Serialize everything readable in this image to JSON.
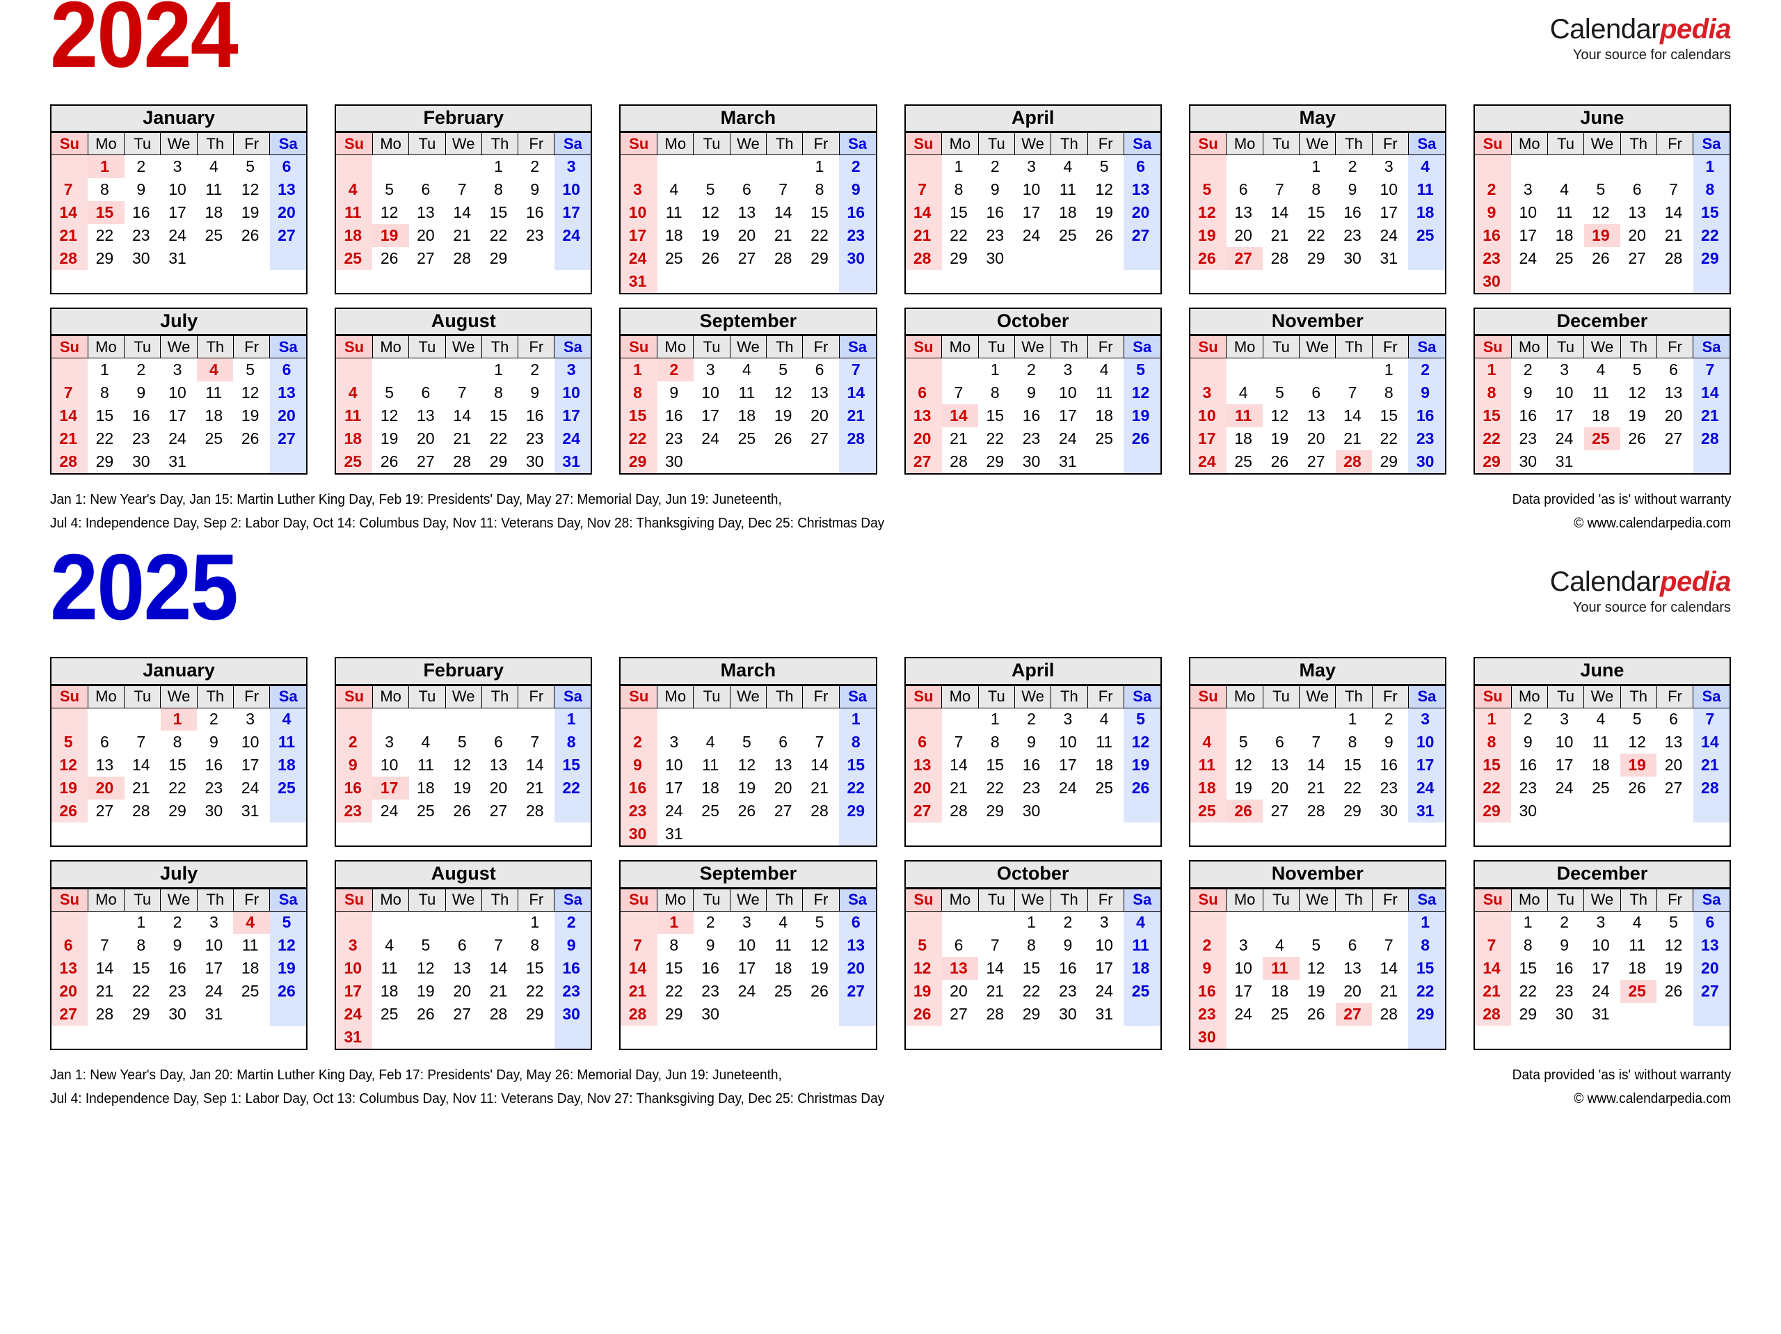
{
  "brand": {
    "name_part1": "Calendar",
    "name_part2": "pedia",
    "tagline": "Your source for calendars"
  },
  "weekday_headers": [
    "Su",
    "Mo",
    "Tu",
    "We",
    "Th",
    "Fr",
    "Sa"
  ],
  "colors": {
    "year_2024": "#cc0000",
    "year_2025": "#0000cc",
    "sunday_bg": "#fcdede",
    "sunday_text": "#cc0000",
    "saturday_bg": "#dbe5fb",
    "saturday_text": "#0000dd",
    "holiday_bg": "#fcdada",
    "holiday_text": "#cc0000",
    "header_bg": "#e8e8e8",
    "brand_red": "#d81f26"
  },
  "years": [
    {
      "id": "y2024",
      "title": "2024",
      "months": [
        {
          "name": "January",
          "first_weekday": 1,
          "days": 31,
          "holidays": [
            1,
            15
          ]
        },
        {
          "name": "February",
          "first_weekday": 4,
          "days": 29,
          "holidays": [
            19
          ]
        },
        {
          "name": "March",
          "first_weekday": 5,
          "days": 31,
          "holidays": []
        },
        {
          "name": "April",
          "first_weekday": 1,
          "days": 30,
          "holidays": []
        },
        {
          "name": "May",
          "first_weekday": 3,
          "days": 31,
          "holidays": [
            27
          ]
        },
        {
          "name": "June",
          "first_weekday": 6,
          "days": 30,
          "holidays": [
            19
          ]
        },
        {
          "name": "July",
          "first_weekday": 1,
          "days": 31,
          "holidays": [
            4
          ]
        },
        {
          "name": "August",
          "first_weekday": 4,
          "days": 31,
          "holidays": []
        },
        {
          "name": "September",
          "first_weekday": 0,
          "days": 30,
          "holidays": [
            2
          ]
        },
        {
          "name": "October",
          "first_weekday": 2,
          "days": 31,
          "holidays": [
            14
          ]
        },
        {
          "name": "November",
          "first_weekday": 5,
          "days": 30,
          "holidays": [
            11,
            28
          ]
        },
        {
          "name": "December",
          "first_weekday": 0,
          "days": 31,
          "holidays": [
            25
          ]
        }
      ],
      "footer_left_line1": "Jan 1: New Year's Day, Jan 15: Martin Luther King Day, Feb 19: Presidents' Day, May 27: Memorial Day, Jun 19: Juneteenth,",
      "footer_left_line2": "Jul 4: Independence Day, Sep 2: Labor Day, Oct 14: Columbus Day, Nov 11: Veterans Day, Nov 28: Thanksgiving Day, Dec 25: Christmas Day",
      "footer_right_line1": "Data provided 'as is' without warranty",
      "footer_right_line2": "© www.calendarpedia.com"
    },
    {
      "id": "y2025",
      "title": "2025",
      "months": [
        {
          "name": "January",
          "first_weekday": 3,
          "days": 31,
          "holidays": [
            1,
            20
          ]
        },
        {
          "name": "February",
          "first_weekday": 6,
          "days": 28,
          "holidays": [
            17
          ]
        },
        {
          "name": "March",
          "first_weekday": 6,
          "days": 31,
          "holidays": []
        },
        {
          "name": "April",
          "first_weekday": 2,
          "days": 30,
          "holidays": []
        },
        {
          "name": "May",
          "first_weekday": 4,
          "days": 31,
          "holidays": [
            26
          ]
        },
        {
          "name": "June",
          "first_weekday": 0,
          "days": 30,
          "holidays": [
            19
          ]
        },
        {
          "name": "July",
          "first_weekday": 2,
          "days": 31,
          "holidays": [
            4
          ]
        },
        {
          "name": "August",
          "first_weekday": 5,
          "days": 31,
          "holidays": []
        },
        {
          "name": "September",
          "first_weekday": 1,
          "days": 30,
          "holidays": [
            1
          ]
        },
        {
          "name": "October",
          "first_weekday": 3,
          "days": 31,
          "holidays": [
            13
          ]
        },
        {
          "name": "November",
          "first_weekday": 6,
          "days": 30,
          "holidays": [
            11,
            27
          ]
        },
        {
          "name": "December",
          "first_weekday": 1,
          "days": 31,
          "holidays": [
            25
          ]
        }
      ],
      "footer_left_line1": "Jan 1: New Year's Day, Jan 20: Martin Luther King Day, Feb 17: Presidents' Day, May 26: Memorial Day, Jun 19: Juneteenth,",
      "footer_left_line2": "Jul 4: Independence Day, Sep 1: Labor Day, Oct 13: Columbus Day, Nov 11: Veterans Day, Nov 27: Thanksgiving Day, Dec 25: Christmas Day",
      "footer_right_line1": "Data provided 'as is' without warranty",
      "footer_right_line2": "© www.calendarpedia.com"
    }
  ]
}
